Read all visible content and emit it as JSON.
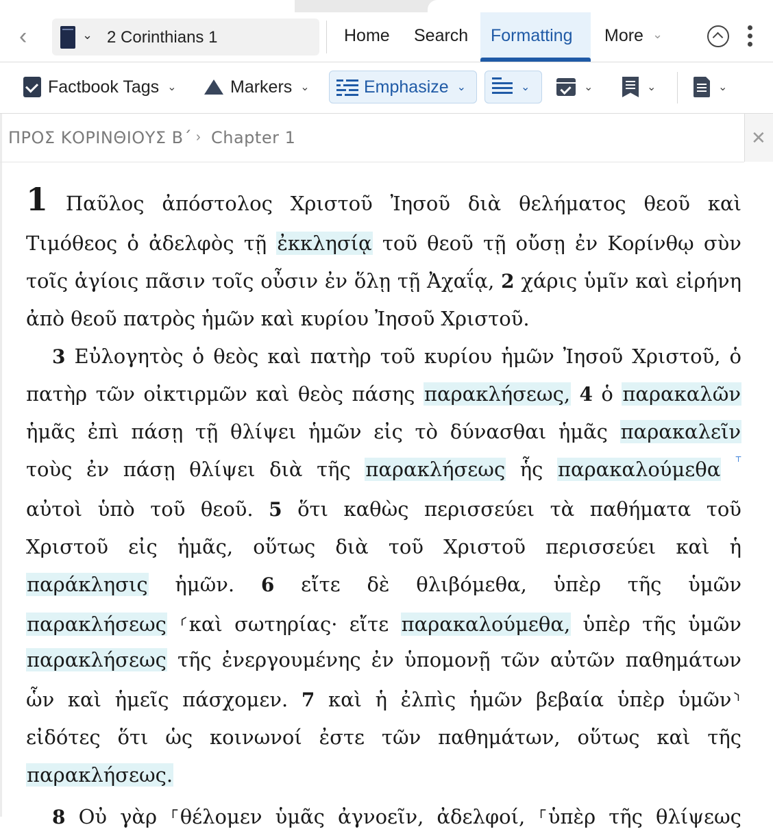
{
  "nav": {
    "reference": "2 Corinthians 1",
    "tabs": [
      {
        "label": "Home"
      },
      {
        "label": "Search"
      },
      {
        "label": "Formatting"
      },
      {
        "label": "More"
      }
    ]
  },
  "toolbar": {
    "factbook_tags": "Factbook Tags",
    "markers": "Markers",
    "emphasize": "Emphasize"
  },
  "breadcrumb": {
    "book": "ΠΡΟΣ ΚΟΡΙΝΘΙΟΥΣ Β΄",
    "chapter": "Chapter 1"
  },
  "colors": {
    "accent": "#1f5aa6",
    "highlight": "#e0f3f6"
  },
  "text": {
    "chapter_number": "1",
    "lines": [
      [
        "Παῦλος",
        "ἀπόστολος",
        "Χριστοῦ",
        "Ἰησοῦ",
        "διὰ",
        "θελήματος",
        "θεοῦ",
        "καὶ"
      ],
      [
        "Τιμόθεος",
        "ὁ",
        "ἀδελφὸς",
        "τῇ",
        "ἐκκλησίᾳ",
        "τοῦ",
        "θεοῦ",
        "τῇ",
        "οὔσῃ",
        "ἐν",
        "Κορίνθῳ",
        "σὺν"
      ],
      [
        "τοῖς",
        "ἁγίοις",
        "πᾶσιν",
        "τοῖς",
        "οὖσιν",
        "ἐν",
        "ὅλῃ",
        "τῇ",
        "Ἀχαΐᾳ,",
        "2",
        "χάρις",
        "ὑμῖν",
        "καὶ",
        "εἰρήνη"
      ],
      [
        "ἀπὸ",
        "θεοῦ",
        "πατρὸς",
        "ἡμῶν",
        "καὶ",
        "κυρίου",
        "Ἰησοῦ",
        "Χριστοῦ."
      ],
      [
        "3",
        "Εὐλογητὸς",
        "ὁ",
        "θεὸς",
        "καὶ",
        "πατὴρ",
        "τοῦ",
        "κυρίου",
        "ἡμῶν",
        "Ἰησοῦ",
        "Χριστοῦ,",
        "ὁ"
      ],
      [
        "πατὴρ",
        "τῶν",
        "οἰκτιρμῶν",
        "καὶ",
        "θεὸς",
        "πάσης",
        "παρακλήσεως,",
        "4",
        "ὁ",
        "παρακαλῶν"
      ],
      [
        "ἡμᾶς",
        "ἐπὶ",
        "πάσῃ",
        "τῇ",
        "θλίψει",
        "ἡμῶν",
        "εἰς",
        "τὸ",
        "δύνασθαι",
        "ἡμᾶς",
        "παρακαλεῖν"
      ],
      [
        "τοὺς",
        "ἐν",
        "πάσῃ",
        "θλίψει",
        "διὰ",
        "τῆς",
        "παρακλήσεως",
        "ἧς",
        "παρακαλούμεθα",
        "⸆"
      ],
      [
        "αὐτοὶ",
        "ὑπὸ",
        "τοῦ",
        "θεοῦ.",
        "5",
        "ὅτι",
        "καθὼς",
        "περισσεύει",
        "τὰ",
        "παθήματα",
        "τοῦ"
      ],
      [
        "Χριστοῦ",
        "εἰς",
        "ἡμᾶς,",
        "οὕτως",
        "διὰ",
        "τοῦ",
        "Χριστοῦ",
        "περισσεύει",
        "καὶ",
        "ἡ"
      ],
      [
        "παράκλησις",
        "ἡμῶν.",
        "6",
        "εἴτε",
        "δὲ",
        "θλιβόμεθα,",
        "ὑπὲρ",
        "τῆς",
        "ὑμῶν"
      ],
      [
        "παρακλήσεως",
        "⸂καὶ",
        "σωτηρίας·",
        "εἴτε",
        "παρακαλούμεθα,",
        "ὑπὲρ",
        "τῆς",
        "ὑμῶν"
      ],
      [
        "παρακλήσεως",
        "τῆς",
        "ἐνεργουμένης",
        "ἐν",
        "ὑπομονῇ",
        "τῶν",
        "αὐτῶν",
        "παθημάτων"
      ],
      [
        "ὧν",
        "καὶ",
        "ἡμεῖς",
        "πάσχομεν.",
        "7",
        "καὶ",
        "ἡ",
        "ἐλπὶς",
        "ἡμῶν",
        "βεβαία",
        "ὑπὲρ",
        "ὑμῶν⸃"
      ],
      [
        "εἰδότες",
        "ὅτι",
        "ὡς",
        "κοινωνοί",
        "ἐστε",
        "τῶν",
        "παθημάτων,",
        "οὕτως",
        "καὶ",
        "τῆς"
      ],
      [
        "παρακλήσεως."
      ],
      [
        "8",
        "Οὐ",
        "γὰρ",
        "⸀θέλομεν",
        "ὑμᾶς",
        "ἀγνοεῖν,",
        "ἀδελφοί,",
        "⸀ὑπὲρ",
        "τῆς",
        "θλίψεως"
      ]
    ]
  }
}
